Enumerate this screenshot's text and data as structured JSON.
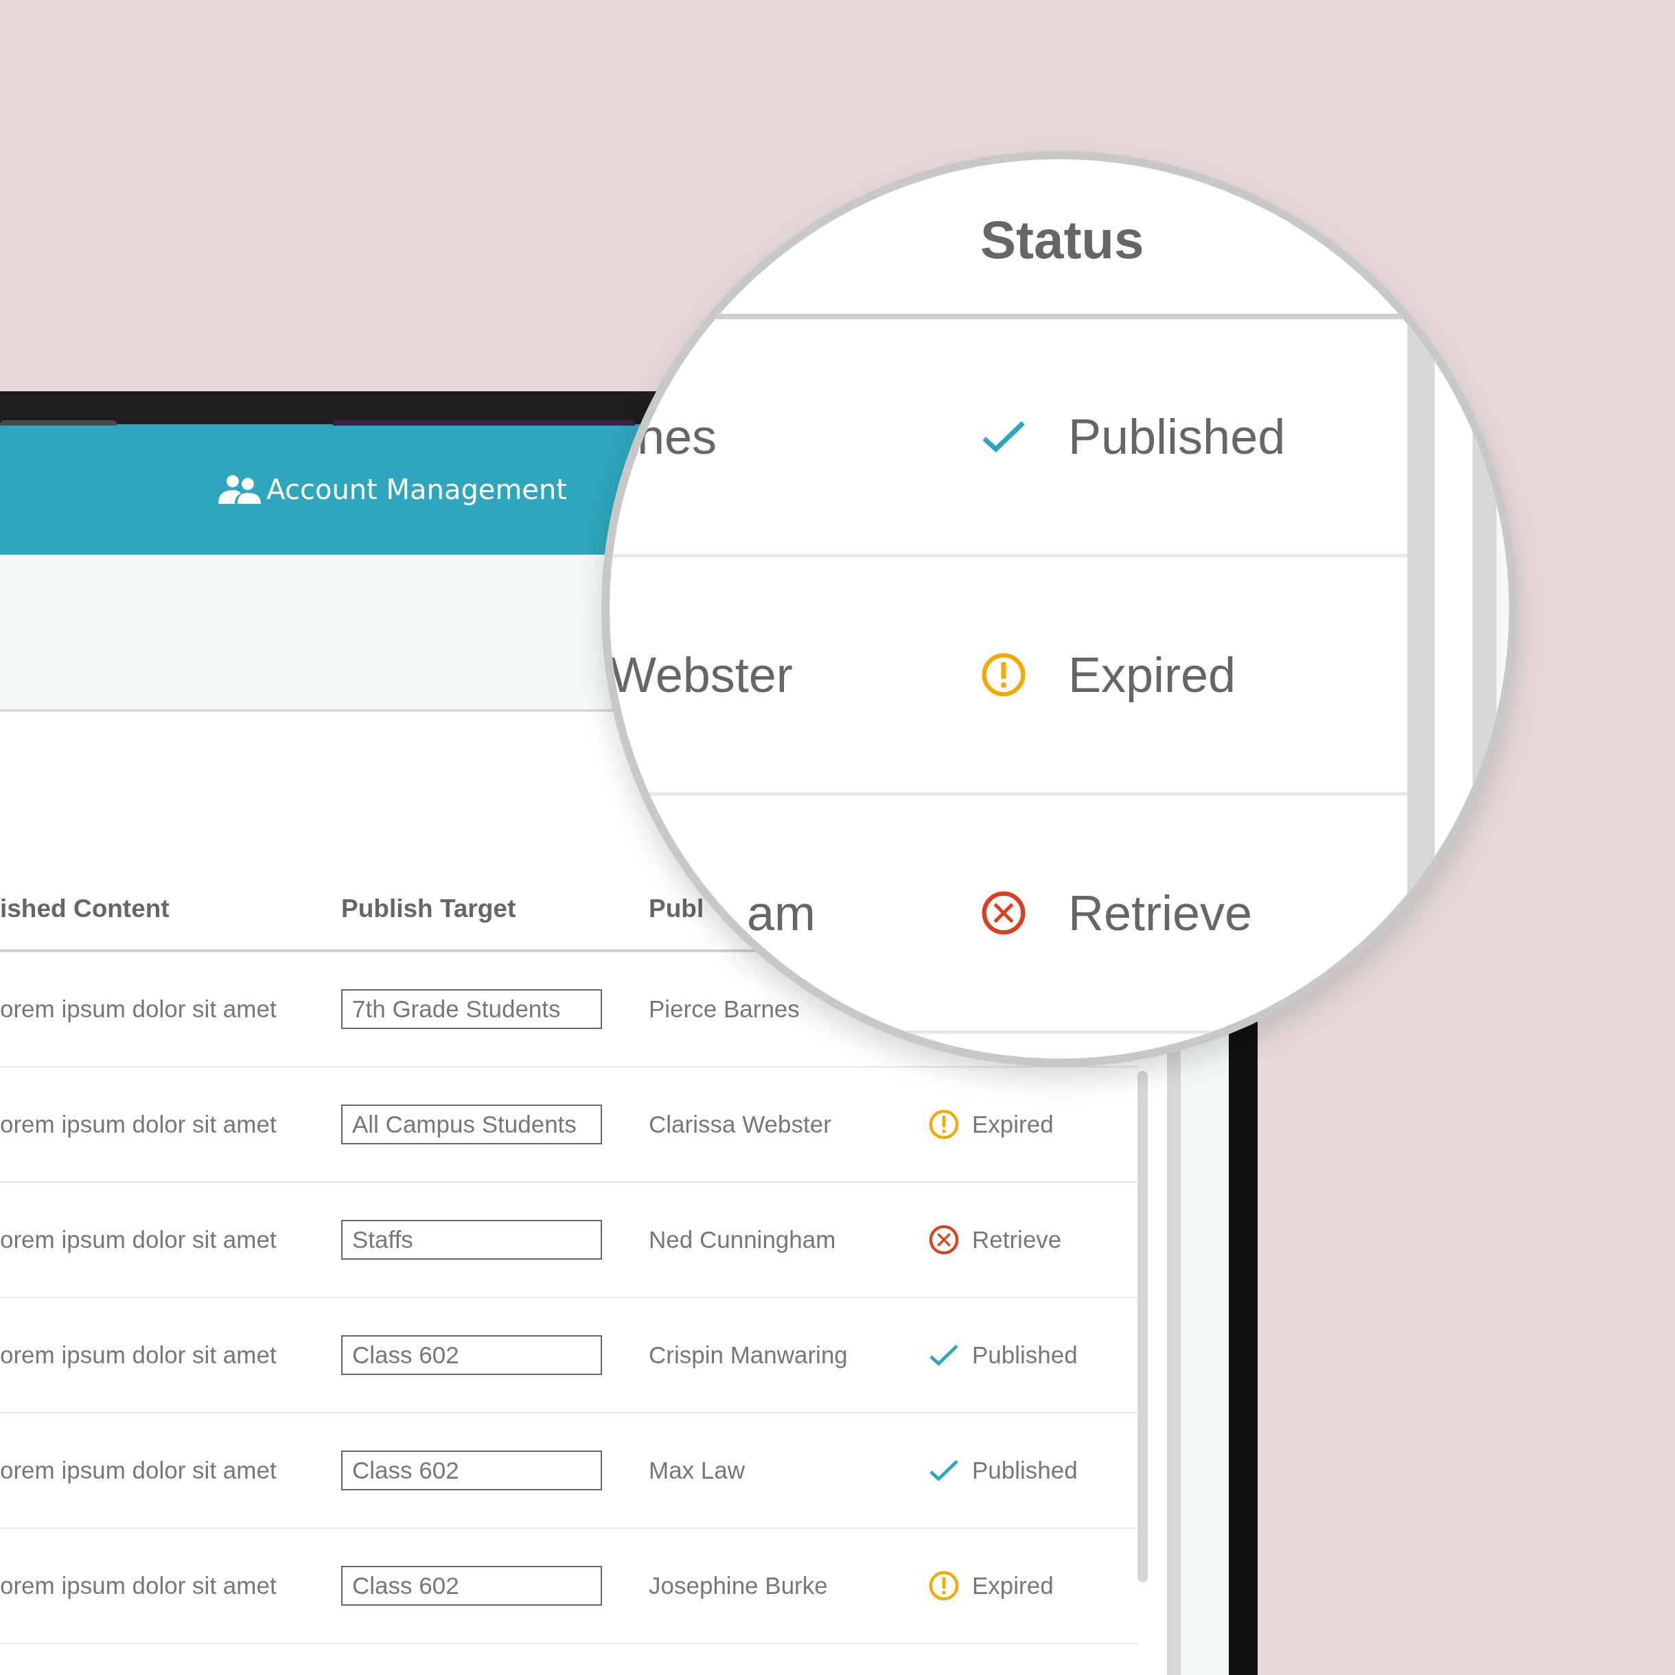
{
  "header": {
    "nav_item": {
      "label": "Account Management"
    }
  },
  "table": {
    "columns": [
      "ished Content",
      "Publish Target",
      "Publ"
    ],
    "rows": [
      {
        "content": "orem ipsum dolor sit amet",
        "target": "7th Grade Students",
        "publisher": "Pierce Barnes"
      },
      {
        "content": "orem ipsum dolor sit amet",
        "target": "All Campus Students",
        "publisher": "Clarissa Webster",
        "status": {
          "kind": "expired",
          "label": "Expired"
        }
      },
      {
        "content": "orem ipsum dolor sit amet",
        "target": "Staffs",
        "publisher": "Ned Cunningham",
        "status": {
          "kind": "retrieve",
          "label": "Retrieve"
        }
      },
      {
        "content": "orem ipsum dolor sit amet",
        "target": "Class 602",
        "publisher": "Crispin Manwaring",
        "status": {
          "kind": "published",
          "label": "Published"
        }
      },
      {
        "content": "orem ipsum dolor sit amet",
        "target": "Class 602",
        "publisher": "Max Law",
        "status": {
          "kind": "published",
          "label": "Published"
        }
      },
      {
        "content": "orem ipsum dolor sit amet",
        "target": "Class 602",
        "publisher": "Josephine Burke",
        "status": {
          "kind": "expired",
          "label": "Expired"
        }
      }
    ]
  },
  "magnifier": {
    "header": "Status",
    "rows": [
      {
        "fragment": "nes",
        "status": {
          "kind": "published",
          "label": "Published"
        }
      },
      {
        "fragment": "Webster",
        "status": {
          "kind": "expired",
          "label": "Expired"
        }
      },
      {
        "fragment": "am",
        "status": {
          "kind": "retrieve",
          "label": "Retrieve"
        }
      }
    ]
  }
}
